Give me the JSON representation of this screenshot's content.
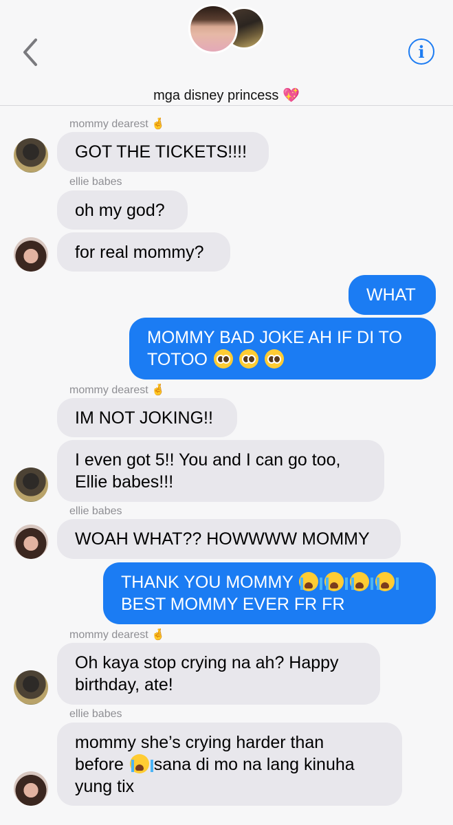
{
  "header": {
    "group_name": "mga disney princess",
    "group_name_emoji": "💖",
    "back_icon": "chevron-left-icon",
    "info_icon": "info-icon",
    "info_glyph": "i",
    "accent_color": "#1d7cf2"
  },
  "messages": [
    {
      "type": "label",
      "text": "mommy dearest",
      "emoji": "🤞"
    },
    {
      "type": "in",
      "sender": "mommy dearest",
      "text": "GOT THE TICKETS!!!!"
    },
    {
      "type": "label",
      "text": "ellie babes"
    },
    {
      "type": "in",
      "sender": "ellie babes",
      "text": "oh my god?"
    },
    {
      "type": "in",
      "sender": "ellie babes",
      "text": "for real mommy?"
    },
    {
      "type": "out",
      "text": "WHAT"
    },
    {
      "type": "out",
      "lines": [
        "MOMMY BAD JOKE AH IF DI TO",
        "TOTOO"
      ],
      "emojis": [
        "pleading-face-icon",
        "pleading-face-icon",
        "pleading-face-icon"
      ]
    },
    {
      "type": "label",
      "text": "mommy dearest",
      "emoji": "🤞"
    },
    {
      "type": "in",
      "sender": "mommy dearest",
      "text": "IM NOT JOKING!!"
    },
    {
      "type": "in",
      "sender": "mommy dearest",
      "lines": [
        "I even got 5!! You and I can go too,",
        "Ellie babes!!!"
      ]
    },
    {
      "type": "label",
      "text": "ellie babes"
    },
    {
      "type": "in",
      "sender": "ellie babes",
      "text": "WOAH WHAT?? HOWWWW MOMMY"
    },
    {
      "type": "out",
      "lines": [
        "THANK YOU MOMMY",
        "BEST MOMMY EVER FR FR"
      ],
      "emojis": [
        "loudly-crying-face-icon",
        "loudly-crying-face-icon",
        "loudly-crying-face-icon",
        "loudly-crying-face-icon"
      ]
    },
    {
      "type": "label",
      "text": "mommy dearest",
      "emoji": "🤞"
    },
    {
      "type": "in",
      "sender": "mommy dearest",
      "lines": [
        "Oh kaya stop crying na ah? Happy",
        "birthday, ate!"
      ]
    },
    {
      "type": "label",
      "text": "ellie babes"
    },
    {
      "type": "in",
      "sender": "ellie babes",
      "lines": [
        "mommy she’s crying harder than",
        "before",
        "sana di mo na lang kinuha",
        "yung tix"
      ],
      "emojis": [
        "loudly-crying-face-icon"
      ]
    }
  ],
  "colors": {
    "incoming_bubble": "#e8e7ec",
    "outgoing_bubble": "#1b7cf3",
    "label_gray": "#8e8e93",
    "background": "#f7f7f8"
  }
}
